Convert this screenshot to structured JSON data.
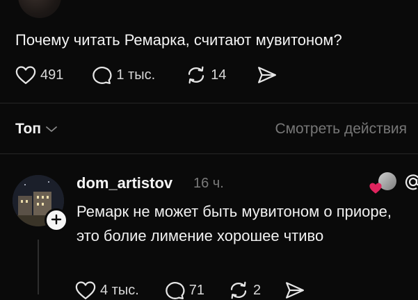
{
  "post": {
    "text": "Почему читать Ремарка, считают мувитоном?",
    "likes": "491",
    "comments": "1 тыс.",
    "reposts": "14"
  },
  "sort": {
    "label": "Топ",
    "view_activity": "Смотреть действия"
  },
  "comment": {
    "username": "dom_artistov",
    "time": "16 ч.",
    "text": "Ремарк не может быть мувитоном о приоре, это болие лимение хорошее чтиво",
    "likes": "4 тыс.",
    "replies": "71",
    "reposts": "2"
  },
  "colors": {
    "background": "#0a0a0a",
    "text": "#f3f3f3",
    "muted": "#777777",
    "heart_badge": "#e0245e"
  },
  "icons": [
    "heart-icon",
    "comment-icon",
    "repost-icon",
    "share-icon",
    "chevron-down-icon",
    "plus-icon",
    "at-icon"
  ]
}
